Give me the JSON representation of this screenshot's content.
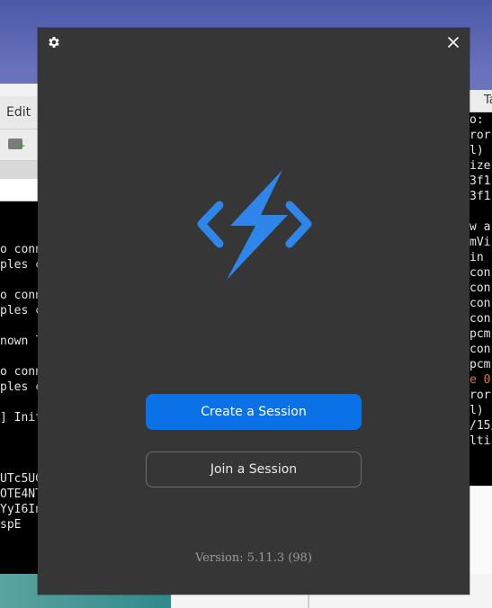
{
  "dialog": {
    "create_label": "Create a Session",
    "join_label": "Join a Session",
    "version_text": "Version: 5.11.3 (98)",
    "accent_color": "#0a72e6",
    "background_color": "#363636",
    "icons": {
      "settings": "gear-icon",
      "close": "close-icon",
      "logo": "bolt-code-logo-icon"
    }
  },
  "background": {
    "left_window": {
      "menu_label": "Edit",
      "terminal_lines": [
        "o conn",
        "ples c",
        "o conn",
        "ples c",
        "nown l",
        "o conn",
        "ples c",
        "] Init",
        "UTc5UC",
        "OTE4NT",
        "YyI6In",
        "spE"
      ]
    },
    "right_window": {
      "tab_label": "Ta",
      "terminal_lines": [
        "o:",
        "ror:",
        "l)",
        "ize",
        "3f1",
        "3f1",
        "w a",
        "mVi",
        "in",
        "con",
        "con",
        "con",
        "con",
        "pcm",
        "con",
        "pcm",
        "e 0",
        "ror:",
        "l)",
        "/15/",
        "lti"
      ]
    }
  }
}
